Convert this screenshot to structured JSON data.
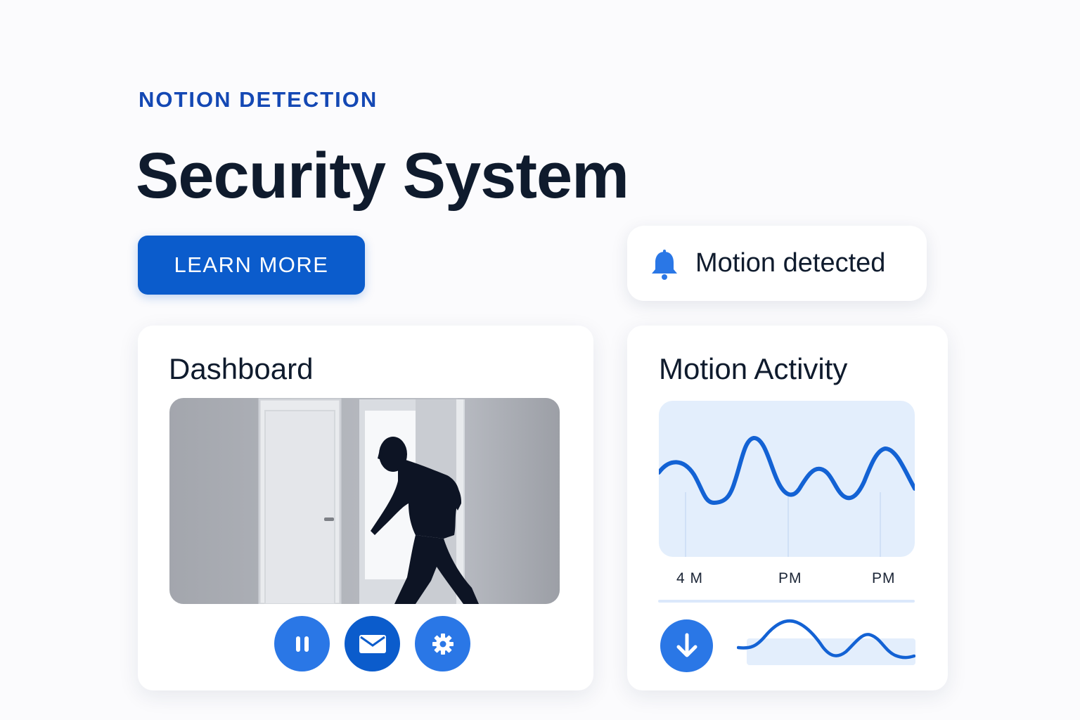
{
  "header": {
    "eyebrow": "NOTION DETECTION",
    "title": "Security System",
    "cta_label": "LEARN MORE"
  },
  "notification": {
    "icon": "bell-icon",
    "text": "Motion detected"
  },
  "dashboard": {
    "title": "Dashboard",
    "feed_description": "camera-feed-image",
    "controls": [
      {
        "name": "pause-button",
        "icon": "pause-icon"
      },
      {
        "name": "mail-button",
        "icon": "mail-icon"
      },
      {
        "name": "settings-button",
        "icon": "gear-icon"
      }
    ]
  },
  "motion_activity": {
    "title": "Motion Activity",
    "ticks": [
      "4 M",
      "PM",
      "PM"
    ],
    "download_icon": "download-icon"
  },
  "colors": {
    "accent": "#0b5ccc",
    "accent_light": "#2a77e6",
    "chart_bg": "#e3eefc",
    "text_dark": "#0f1b2d",
    "eyebrow": "#1448b4"
  }
}
